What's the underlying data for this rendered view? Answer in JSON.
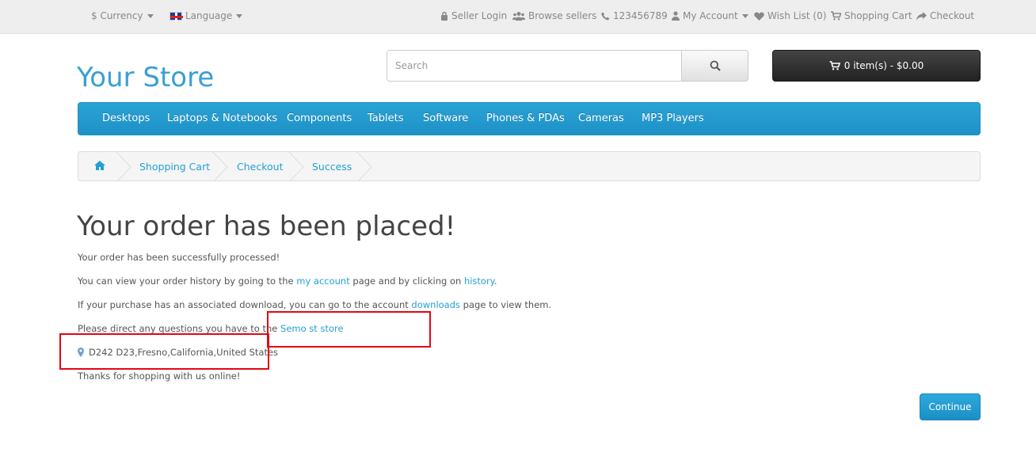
{
  "topbar": {
    "currency": "$ Currency",
    "language": "Language",
    "seller_login": "Seller Login",
    "browse_sellers": "Browse sellers",
    "phone": "123456789",
    "my_account": "My Account",
    "wish_list": "Wish List (0)",
    "shopping_cart": "Shopping Cart",
    "checkout": "Checkout"
  },
  "header": {
    "logo": "Your Store",
    "search_placeholder": "Search",
    "cart": "0 item(s) - $0.00"
  },
  "menu": [
    "Desktops",
    "Laptops & Notebooks",
    "Components",
    "Tablets",
    "Software",
    "Phones & PDAs",
    "Cameras",
    "MP3 Players"
  ],
  "breadcrumb": [
    "Shopping Cart",
    "Checkout",
    "Success"
  ],
  "content": {
    "title": "Your order has been placed!",
    "line1": "Your order has been successfully processed!",
    "line2_pre": "You can view your order history by going to the ",
    "line2_link1": "my account",
    "line2_mid": " page and by clicking on ",
    "line2_link2": "history",
    "line2_post": ".",
    "line3_pre": "If your purchase has an associated download, you can go to the account ",
    "line3_link": "downloads",
    "line3_post": " page to view them.",
    "line4_pre": "Please direct any questions you have to the ",
    "line4_link": "Semo st store",
    "address": "D242 D23,Fresno,California,United States",
    "thanks": "Thanks for shopping with us online!",
    "continue": "Continue"
  },
  "colors": {
    "accent": "#23a1d1",
    "highlight": "#e30613",
    "menu": "#229ac8"
  }
}
